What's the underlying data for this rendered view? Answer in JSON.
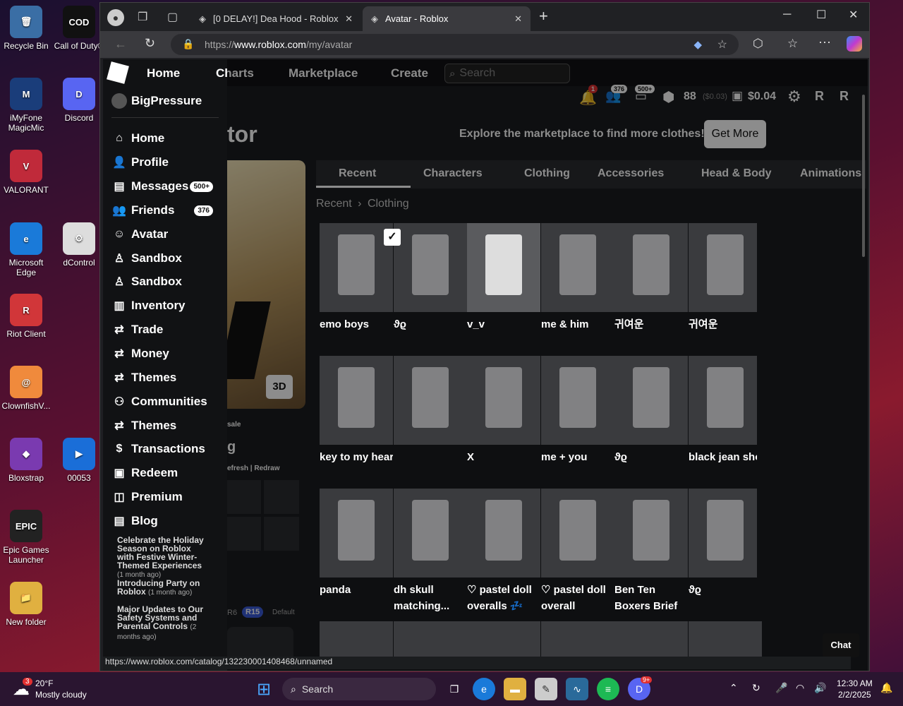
{
  "desktop": {
    "icons": [
      {
        "label": "Recycle Bin",
        "glyph": "🗑",
        "color": "#3a6ea5"
      },
      {
        "label": "Call of Duty®",
        "glyph": "COD",
        "color": "#111"
      },
      {
        "label": "iMyFone MagicMic",
        "glyph": "M",
        "color": "#1a3d7a"
      },
      {
        "label": "Discord",
        "glyph": "D",
        "color": "#5865f2"
      },
      {
        "label": "VALORANT",
        "glyph": "V",
        "color": "#c02a3a"
      },
      {
        "label": "Microsoft Edge",
        "glyph": "e",
        "color": "#1a7ad9"
      },
      {
        "label": "dControl",
        "glyph": "⚙",
        "color": "#ddd"
      },
      {
        "label": "Riot Client",
        "glyph": "R",
        "color": "#d13639"
      },
      {
        "label": "ClownfishV...",
        "glyph": "@",
        "color": "#f08a3c"
      },
      {
        "label": "Bloxstrap",
        "glyph": "◆",
        "color": "#7a3ab0"
      },
      {
        "label": "00053",
        "glyph": "▶",
        "color": "#1a6ed8"
      },
      {
        "label": "Epic Games Launcher",
        "glyph": "EPIC",
        "color": "#222"
      },
      {
        "label": "New folder",
        "glyph": "📁",
        "color": "#e0b040"
      }
    ]
  },
  "browser": {
    "tabs": [
      {
        "label": "[0 DELAY!] Dea Hood - Roblox"
      },
      {
        "label": "Avatar - Roblox"
      }
    ],
    "url_prefix": "https://",
    "url_domain": "www.roblox.com",
    "url_path": "/my/avatar",
    "status_url": "https://www.roblox.com/catalog/132230001408468/unnamed"
  },
  "nav": {
    "home": "Home",
    "charts": "Charts",
    "marketplace": "Marketplace",
    "create": "Create",
    "search_placeholder": "Search",
    "notif_count": "1",
    "friends_count": "376",
    "messages_count": "500+",
    "robux": "88",
    "robux_value": "($0.03)",
    "wallet": "$0.04"
  },
  "sidebar": {
    "username": "BigPressure",
    "items": [
      {
        "label": "Home",
        "icon": "home-icon",
        "glyph": "⌂"
      },
      {
        "label": "Profile",
        "icon": "profile-icon",
        "glyph": "👤"
      },
      {
        "label": "Messages",
        "icon": "messages-icon",
        "glyph": "▤",
        "badge": "500+"
      },
      {
        "label": "Friends",
        "icon": "friends-icon",
        "glyph": "👥",
        "badge": "376"
      },
      {
        "label": "Avatar",
        "icon": "avatar-icon",
        "glyph": "☺"
      },
      {
        "label": "Sandbox",
        "icon": "sandbox-icon",
        "glyph": "♙"
      },
      {
        "label": "Sandbox",
        "icon": "sandbox-icon",
        "glyph": "♙"
      },
      {
        "label": "Inventory",
        "icon": "inventory-icon",
        "glyph": "▥"
      },
      {
        "label": "Trade",
        "icon": "trade-icon",
        "glyph": "⇄"
      },
      {
        "label": "Money",
        "icon": "money-icon",
        "glyph": "⇄"
      },
      {
        "label": "Themes",
        "icon": "themes-icon",
        "glyph": "⇄"
      },
      {
        "label": "Communities",
        "icon": "communities-icon",
        "glyph": "⚇"
      },
      {
        "label": "Themes",
        "icon": "themes-icon",
        "glyph": "⇄"
      },
      {
        "label": "Transactions",
        "icon": "transactions-icon",
        "glyph": "$"
      },
      {
        "label": "Redeem",
        "icon": "redeem-icon",
        "glyph": "▣"
      },
      {
        "label": "Premium",
        "icon": "premium-icon",
        "glyph": "◫"
      },
      {
        "label": "Blog",
        "icon": "blog-icon",
        "glyph": "▤"
      }
    ],
    "blog": [
      {
        "title": "Celebrate the Holiday Season on Roblox with Festive Winter-Themed Experiences",
        "age": "(1 month ago)"
      },
      {
        "title": "Introducing Party on Roblox",
        "age": "(1 month ago)"
      },
      {
        "title": "Major Updates to Our Safety Systems and Parental Controls",
        "age": "(2 months ago)"
      }
    ]
  },
  "editor": {
    "title_fragment": "tor",
    "promo_text": "Explore the marketplace to find more clothes!",
    "get_more": "Get More",
    "btn_3d": "3D",
    "fragment_sale": "sale",
    "fragment_g": "g",
    "refresh": "efresh | Redraw",
    "r6": "R6",
    "r15": "R15",
    "default": "Default"
  },
  "categories": [
    "Recent",
    "Characters",
    "Clothing",
    "Accessories",
    "Head & Body",
    "Animations"
  ],
  "breadcrumb": {
    "first": "Recent",
    "sep": "›",
    "second": "Clothing"
  },
  "items": [
    [
      "emo boys",
      "ϑϱ",
      "v_v",
      "me & him",
      "귀여운",
      "귀여운"
    ],
    [
      "key to my heart",
      "",
      "X",
      "me + you",
      "ϑϱ",
      "black jean sho"
    ],
    [
      "panda",
      "dh skull matching...",
      "♡ pastel doll overalls 💤",
      "♡ pastel doll overall sleeves",
      "Ben Ten Boxers Brief",
      "ϑϱ"
    ]
  ],
  "chat": "Chat",
  "taskbar": {
    "weather_temp": "20°F",
    "weather_desc": "Mostly cloudy",
    "weather_badge": "3",
    "search": "Search",
    "time": "12:30 AM",
    "date": "2/2/2025",
    "discord_badge": "9+"
  }
}
